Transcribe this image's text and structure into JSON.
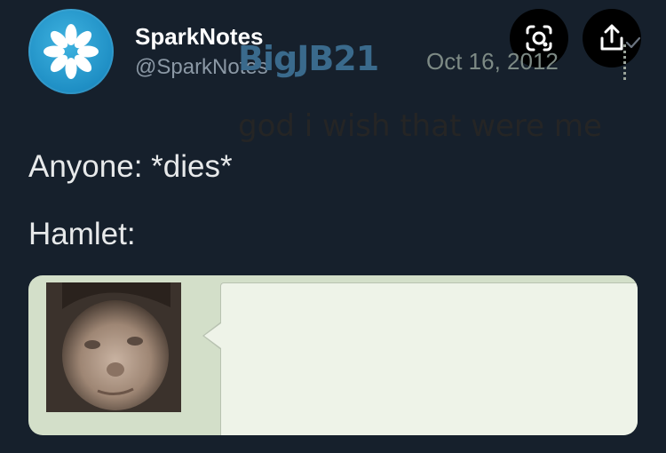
{
  "tweet": {
    "display_name": "SparkNotes",
    "handle": "@SparkNotes",
    "line1": "Anyone: *dies*",
    "line2": "Hamlet:"
  },
  "icons": {
    "avatar": "sparknotes-logo-icon",
    "lens": "lens-icon",
    "share": "share-icon",
    "tick": "checkmark-icon"
  },
  "media": {
    "username": "BigJB21",
    "date": "Oct 16, 2012",
    "comment": "god i wish that were me"
  },
  "colors": {
    "background": "#16202c",
    "username": "#3a6a8c",
    "bubble": "#eef3e8"
  }
}
